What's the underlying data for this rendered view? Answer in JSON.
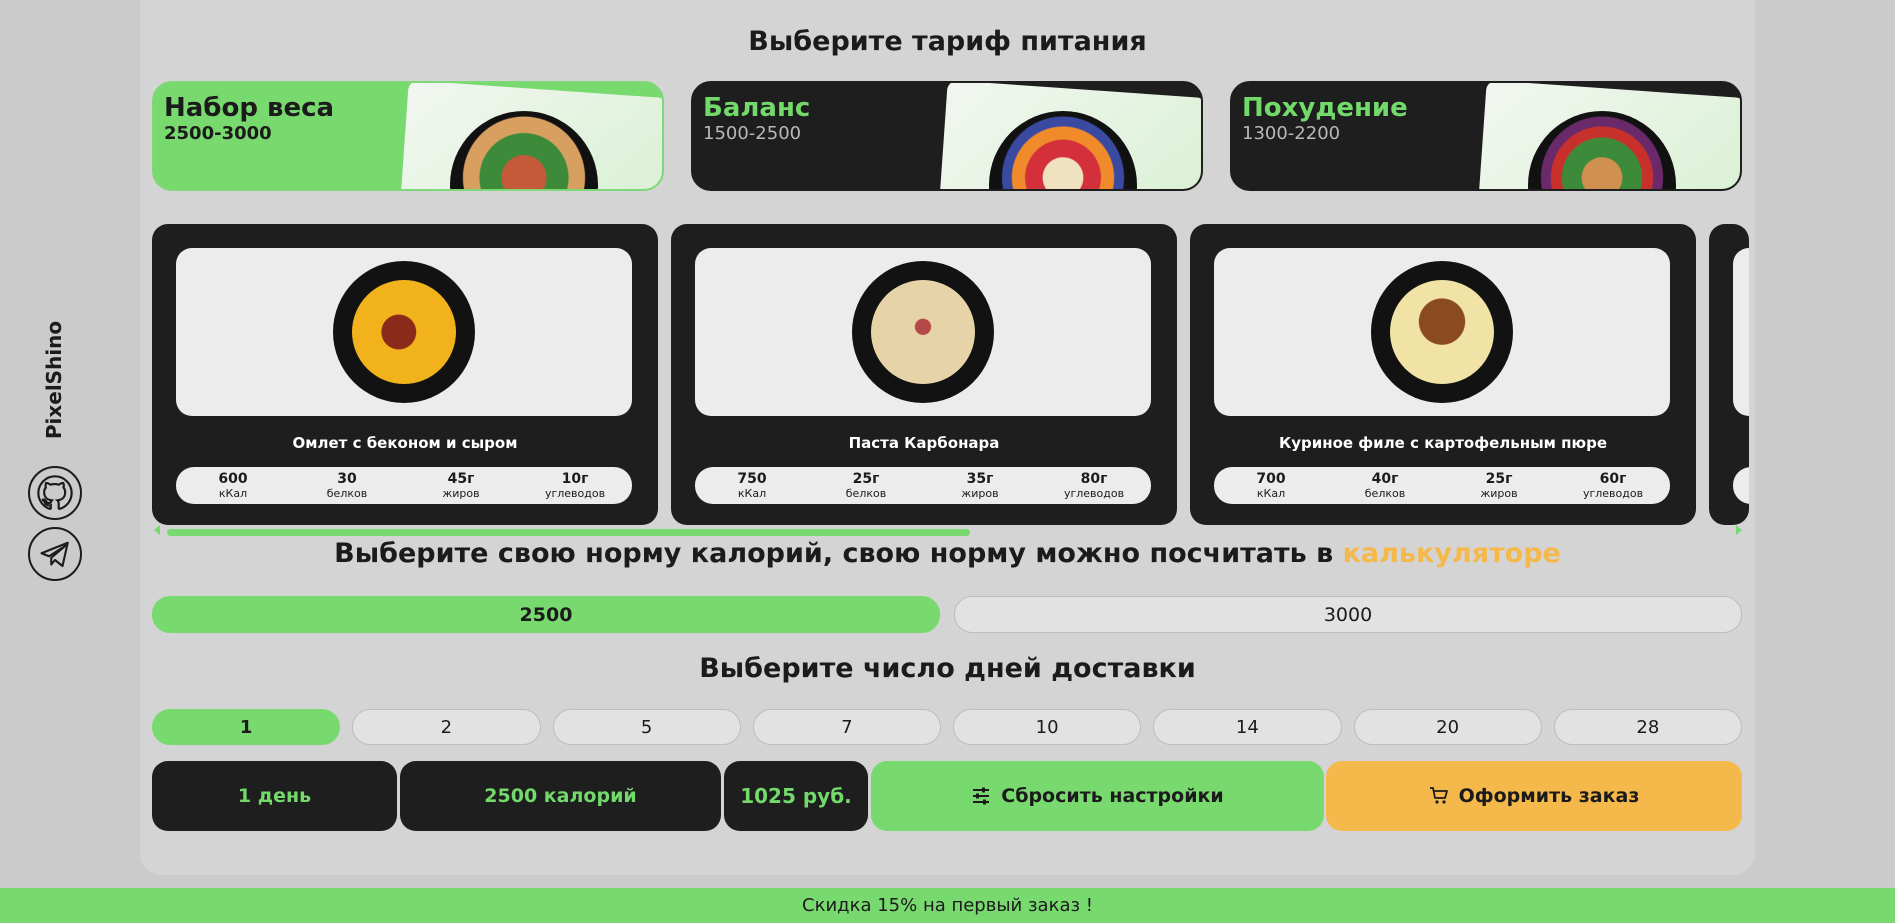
{
  "brand": "PixelShino",
  "social": [
    {
      "icon": "github-icon"
    },
    {
      "icon": "telegram-icon"
    }
  ],
  "headings": {
    "tariff": "Выберите тариф питания",
    "calories_prefix": "Выберите свою норму калорий, свою норму можно посчитать в ",
    "calories_link": "калькуляторе",
    "days": "Выберите число дней доставки"
  },
  "plans": [
    {
      "name": "Набор веса",
      "range": "2500-3000",
      "active": true
    },
    {
      "name": "Баланс",
      "range": "1500-2500",
      "active": false
    },
    {
      "name": "Похудение",
      "range": "1300-2200",
      "active": false
    }
  ],
  "dishes": [
    {
      "name": "Омлет с беконом и сыром",
      "kcal": "600",
      "protein": "30",
      "fat": "45г",
      "carbs": "10г"
    },
    {
      "name": "Паста Карбонара",
      "kcal": "750",
      "protein": "25г",
      "fat": "35г",
      "carbs": "80г"
    },
    {
      "name": "Куриное филе с картофельным пюре",
      "kcal": "700",
      "protein": "40г",
      "fat": "25г",
      "carbs": "60г"
    }
  ],
  "macro_labels": {
    "kcal": "кКал",
    "protein": "белков",
    "fat": "жиров",
    "carbs": "углеводов"
  },
  "calories": {
    "options": [
      "2500",
      "3000"
    ],
    "selected": "2500"
  },
  "days": {
    "options": [
      "1",
      "2",
      "5",
      "7",
      "10",
      "14",
      "20",
      "28"
    ],
    "selected": "1"
  },
  "summary": {
    "days": "1 день",
    "calories": "2500 калорий",
    "price": "1025 руб."
  },
  "buttons": {
    "reset": "Сбросить настройки",
    "order": "Оформить заказ"
  },
  "promo": "Скидка 15% на первый заказ !",
  "colors": {
    "accent_green": "#78d96f",
    "accent_orange": "#f4b94a",
    "dark": "#1e1e1e"
  }
}
